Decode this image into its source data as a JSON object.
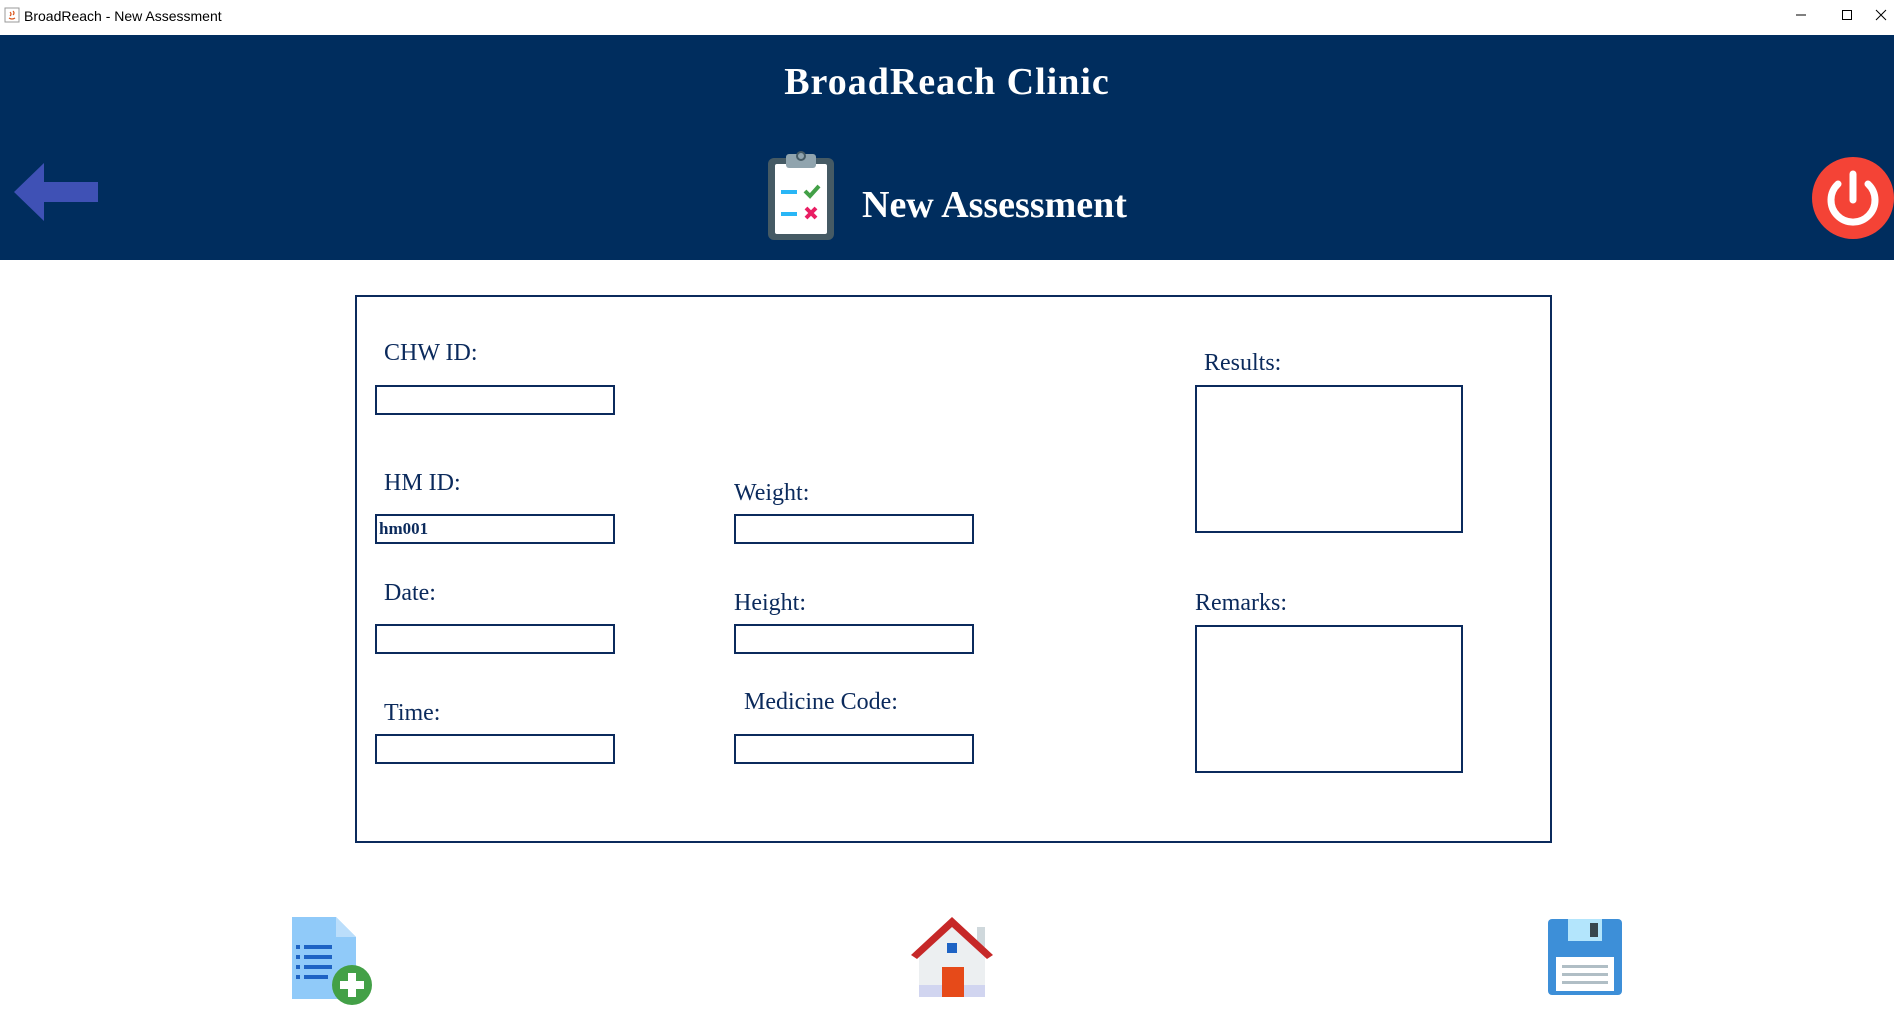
{
  "window": {
    "title": "BroadReach - New Assessment"
  },
  "header": {
    "clinic_name": "BroadReach Clinic",
    "page_title": "New Assessment"
  },
  "form": {
    "chw_id": {
      "label": "CHW ID:",
      "value": ""
    },
    "hm_id": {
      "label": "HM ID:",
      "value": "hm001"
    },
    "date": {
      "label": "Date:",
      "value": ""
    },
    "time": {
      "label": "Time:",
      "value": ""
    },
    "weight": {
      "label": "Weight:",
      "value": ""
    },
    "height": {
      "label": "Height:",
      "value": ""
    },
    "medicine_code": {
      "label": "Medicine Code:",
      "value": ""
    },
    "results": {
      "label": "Results:",
      "value": ""
    },
    "remarks": {
      "label": "Remarks:",
      "value": ""
    }
  },
  "icons": {
    "back": "arrow-left-icon",
    "power": "power-icon",
    "clipboard": "clipboard-checklist-icon",
    "new_document": "add-document-icon",
    "home": "home-icon",
    "save": "floppy-disk-icon"
  },
  "colors": {
    "header_bg": "#002d5e",
    "text": "#0b2a5c",
    "back_arrow": "#3f51b5",
    "power": "#f44336"
  }
}
